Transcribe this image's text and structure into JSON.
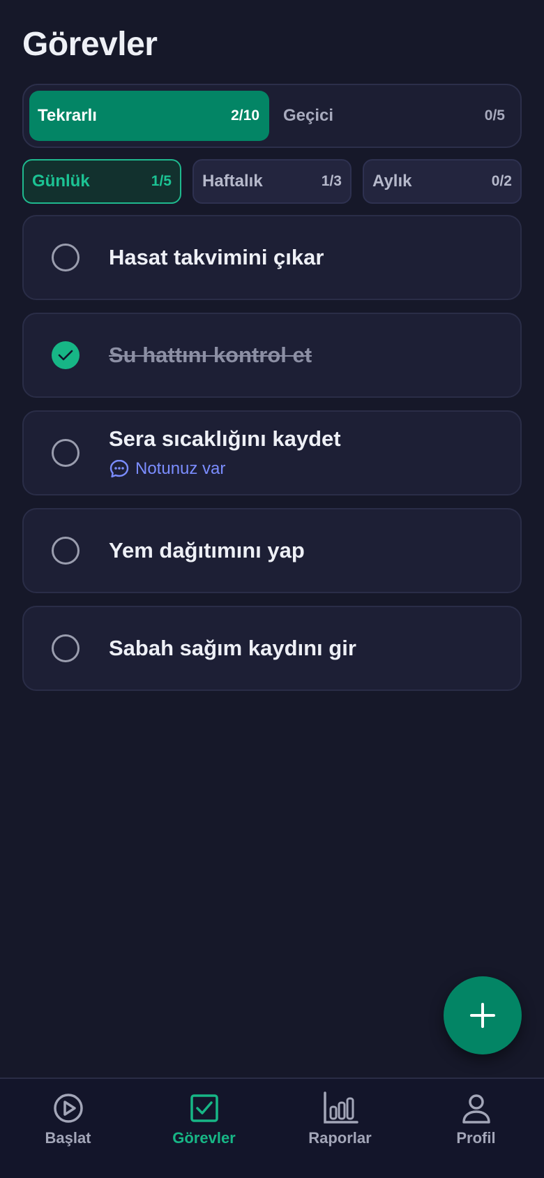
{
  "header": {
    "title": "Görevler"
  },
  "segment": {
    "tabs": [
      {
        "label": "Tekrarlı",
        "count": "2/10",
        "active": true
      },
      {
        "label": "Geçici",
        "count": "0/5",
        "active": false
      }
    ]
  },
  "periods": [
    {
      "label": "Günlük",
      "count": "1/5",
      "active": true
    },
    {
      "label": "Haftalık",
      "count": "1/3",
      "active": false
    },
    {
      "label": "Aylık",
      "count": "0/2",
      "active": false
    }
  ],
  "tasks": [
    {
      "title": "Hasat takvimini çıkar",
      "done": false
    },
    {
      "title": "Su hattını kontrol et",
      "done": true
    },
    {
      "title": "Sera sıcaklığını kaydet",
      "done": false,
      "note": "Notunuz var"
    },
    {
      "title": "Yem dağıtımını yap",
      "done": false
    },
    {
      "title": "Sabah sağım kaydını gir",
      "done": false
    }
  ],
  "fab": {
    "icon": "plus-icon"
  },
  "bottom_nav": [
    {
      "label": "Başlat",
      "icon": "play-circle-icon",
      "active": false
    },
    {
      "label": "Görevler",
      "icon": "checkbox-icon",
      "active": true
    },
    {
      "label": "Raporlar",
      "icon": "bar-chart-icon",
      "active": false
    },
    {
      "label": "Profil",
      "icon": "user-icon",
      "active": false
    }
  ],
  "colors": {
    "background": "#161829",
    "accent": "#038565",
    "accent_text": "#1cc394",
    "note_link": "#7b8dff"
  }
}
